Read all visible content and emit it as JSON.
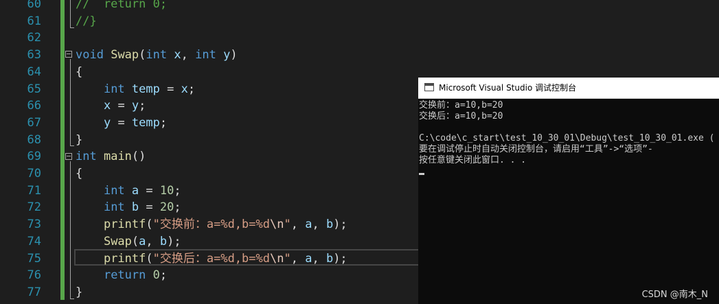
{
  "editor": {
    "line_numbers": [
      "60",
      "61",
      "62",
      "63",
      "64",
      "65",
      "66",
      "67",
      "68",
      "69",
      "70",
      "71",
      "72",
      "73",
      "74",
      "75",
      "76",
      "77"
    ],
    "lines": [
      {
        "num": "60",
        "tokens": [
          {
            "t": "cmt",
            "v": "//  return 0;"
          }
        ]
      },
      {
        "num": "61",
        "tokens": [
          {
            "t": "cmt",
            "v": "//}"
          }
        ]
      },
      {
        "num": "62",
        "tokens": []
      },
      {
        "num": "63",
        "tokens": [
          {
            "t": "kw",
            "v": "void"
          },
          {
            "t": "plain",
            "v": " "
          },
          {
            "t": "fn",
            "v": "Swap"
          },
          {
            "t": "plain",
            "v": "("
          },
          {
            "t": "kw",
            "v": "int"
          },
          {
            "t": "plain",
            "v": " "
          },
          {
            "t": "var",
            "v": "x"
          },
          {
            "t": "plain",
            "v": ", "
          },
          {
            "t": "kw",
            "v": "int"
          },
          {
            "t": "plain",
            "v": " "
          },
          {
            "t": "var",
            "v": "y"
          },
          {
            "t": "plain",
            "v": ")"
          }
        ]
      },
      {
        "num": "64",
        "tokens": [
          {
            "t": "plain",
            "v": "{"
          }
        ]
      },
      {
        "num": "65",
        "tokens": [
          {
            "t": "plain",
            "v": "    "
          },
          {
            "t": "kw",
            "v": "int"
          },
          {
            "t": "plain",
            "v": " "
          },
          {
            "t": "var",
            "v": "temp"
          },
          {
            "t": "plain",
            "v": " = "
          },
          {
            "t": "var",
            "v": "x"
          },
          {
            "t": "plain",
            "v": ";"
          }
        ]
      },
      {
        "num": "66",
        "tokens": [
          {
            "t": "plain",
            "v": "    "
          },
          {
            "t": "var",
            "v": "x"
          },
          {
            "t": "plain",
            "v": " = "
          },
          {
            "t": "var",
            "v": "y"
          },
          {
            "t": "plain",
            "v": ";"
          }
        ]
      },
      {
        "num": "67",
        "tokens": [
          {
            "t": "plain",
            "v": "    "
          },
          {
            "t": "var",
            "v": "y"
          },
          {
            "t": "plain",
            "v": " = "
          },
          {
            "t": "var",
            "v": "temp"
          },
          {
            "t": "plain",
            "v": ";"
          }
        ]
      },
      {
        "num": "68",
        "tokens": [
          {
            "t": "plain",
            "v": "}"
          }
        ]
      },
      {
        "num": "69",
        "tokens": [
          {
            "t": "kw",
            "v": "int"
          },
          {
            "t": "plain",
            "v": " "
          },
          {
            "t": "fn",
            "v": "main"
          },
          {
            "t": "plain",
            "v": "()"
          }
        ]
      },
      {
        "num": "70",
        "tokens": [
          {
            "t": "plain",
            "v": "{"
          }
        ]
      },
      {
        "num": "71",
        "tokens": [
          {
            "t": "plain",
            "v": "    "
          },
          {
            "t": "kw",
            "v": "int"
          },
          {
            "t": "plain",
            "v": " "
          },
          {
            "t": "var",
            "v": "a"
          },
          {
            "t": "plain",
            "v": " = "
          },
          {
            "t": "num",
            "v": "10"
          },
          {
            "t": "plain",
            "v": ";"
          }
        ]
      },
      {
        "num": "72",
        "tokens": [
          {
            "t": "plain",
            "v": "    "
          },
          {
            "t": "kw",
            "v": "int"
          },
          {
            "t": "plain",
            "v": " "
          },
          {
            "t": "var",
            "v": "b"
          },
          {
            "t": "plain",
            "v": " = "
          },
          {
            "t": "num",
            "v": "20"
          },
          {
            "t": "plain",
            "v": ";"
          }
        ]
      },
      {
        "num": "73",
        "tokens": [
          {
            "t": "plain",
            "v": "    "
          },
          {
            "t": "fn",
            "v": "printf"
          },
          {
            "t": "plain",
            "v": "("
          },
          {
            "t": "str",
            "v": "\"交换前：a=%d,b=%d"
          },
          {
            "t": "esc",
            "v": "\\n"
          },
          {
            "t": "str",
            "v": "\""
          },
          {
            "t": "plain",
            "v": ", "
          },
          {
            "t": "var",
            "v": "a"
          },
          {
            "t": "plain",
            "v": ", "
          },
          {
            "t": "var",
            "v": "b"
          },
          {
            "t": "plain",
            "v": ");"
          }
        ]
      },
      {
        "num": "74",
        "tokens": [
          {
            "t": "plain",
            "v": "    "
          },
          {
            "t": "fn",
            "v": "Swap"
          },
          {
            "t": "plain",
            "v": "("
          },
          {
            "t": "var",
            "v": "a"
          },
          {
            "t": "plain",
            "v": ", "
          },
          {
            "t": "var",
            "v": "b"
          },
          {
            "t": "plain",
            "v": ");"
          }
        ]
      },
      {
        "num": "75",
        "tokens": [
          {
            "t": "plain",
            "v": "    "
          },
          {
            "t": "fn",
            "v": "printf"
          },
          {
            "t": "plain",
            "v": "("
          },
          {
            "t": "str",
            "v": "\"交换后：a=%d,b=%d"
          },
          {
            "t": "esc",
            "v": "\\n"
          },
          {
            "t": "str",
            "v": "\""
          },
          {
            "t": "plain",
            "v": ", "
          },
          {
            "t": "var",
            "v": "a"
          },
          {
            "t": "plain",
            "v": ", "
          },
          {
            "t": "var",
            "v": "b"
          },
          {
            "t": "plain",
            "v": ");"
          }
        ]
      },
      {
        "num": "76",
        "tokens": [
          {
            "t": "plain",
            "v": "    "
          },
          {
            "t": "kw",
            "v": "return"
          },
          {
            "t": "plain",
            "v": " "
          },
          {
            "t": "num",
            "v": "0"
          },
          {
            "t": "plain",
            "v": ";"
          }
        ]
      },
      {
        "num": "77",
        "tokens": [
          {
            "t": "plain",
            "v": "}"
          }
        ]
      }
    ],
    "colors": {
      "keyword": "#569cd6",
      "function": "#dcdcaa",
      "variable": "#9cdcfe",
      "number": "#b5cea8",
      "string": "#d69d85",
      "comment": "#57a64a",
      "line_number": "#2b91af",
      "background": "#1e1e1e"
    }
  },
  "console": {
    "title": "Microsoft Visual Studio 调试控制台",
    "icon": "console-window-icon",
    "output": [
      "交换前：a=10,b=20",
      "交换后：a=10,b=20",
      "",
      "C:\\code\\c_start\\test_10_30_01\\Debug\\test_10_30_01.exe (",
      "要在调试停止时自动关闭控制台，请启用“工具”->“选项”-",
      "按任意键关闭此窗口. . ."
    ]
  },
  "watermark": "CSDN @南木_N"
}
